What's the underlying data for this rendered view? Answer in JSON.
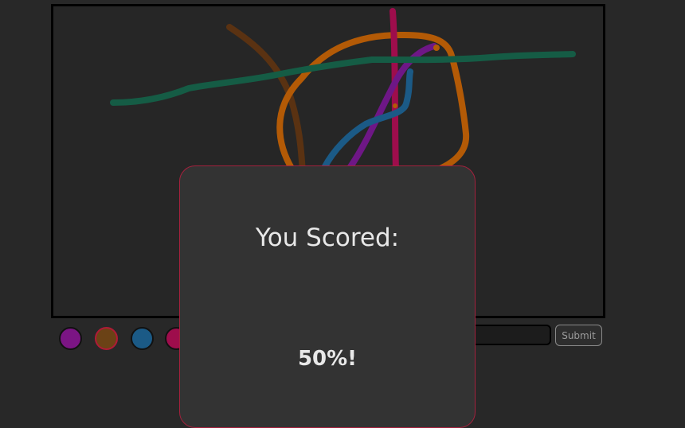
{
  "palette": {
    "swatches": [
      {
        "name": "purple",
        "color": "#7b1584"
      },
      {
        "name": "brown",
        "color": "#6b4216",
        "selected": true
      },
      {
        "name": "blue",
        "color": "#1b5a86"
      },
      {
        "name": "crimson",
        "color": "#9e0d4c"
      }
    ]
  },
  "strokes": [
    {
      "color": "#5a3212"
    },
    {
      "color": "#b35a06"
    },
    {
      "color": "#9e0d4c"
    },
    {
      "color": "#6e1786"
    },
    {
      "color": "#1b5a86"
    },
    {
      "color": "#155c45"
    }
  ],
  "guess": {
    "value": "",
    "submit_label": "Submit"
  },
  "score_modal": {
    "title": "You Scored:",
    "score": "50%!",
    "accent_color": "#a3213d"
  }
}
